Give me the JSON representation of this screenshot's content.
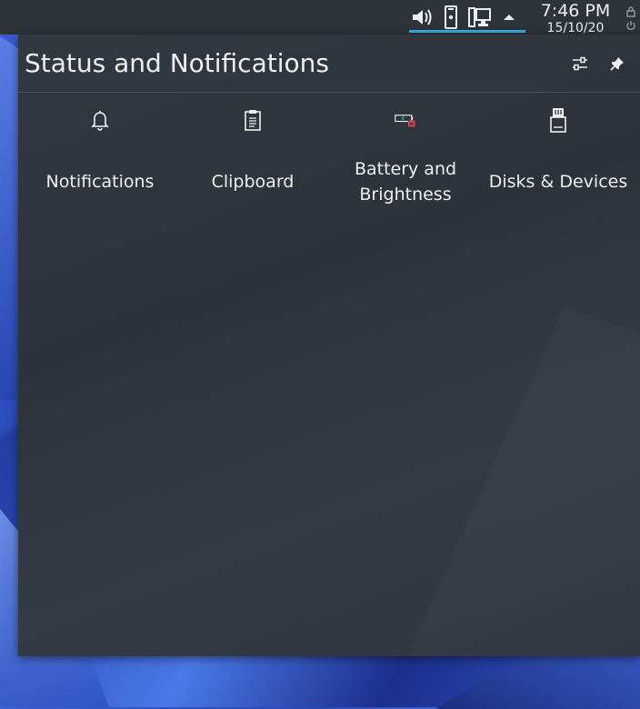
{
  "panel": {
    "clock": {
      "time": "7:46 PM",
      "date": "15/10/20"
    },
    "tray_icons": [
      "volume-icon",
      "kdeconnect-phone-icon",
      "network-wired-icon",
      "expand-arrow-icon"
    ],
    "side_icons": [
      "lock-icon",
      "power-icon"
    ]
  },
  "popup": {
    "title": "Status and Notifications",
    "header_buttons": [
      "configure-icon",
      "pin-icon"
    ],
    "applets": [
      {
        "label": "Notifications",
        "icon": "bell-icon"
      },
      {
        "label": "Clipboard",
        "icon": "clipboard-icon"
      },
      {
        "label_line1": "Battery and",
        "label_line2": "Brightness",
        "icon": "battery-missing-icon"
      },
      {
        "label": "Disks & Devices",
        "icon": "drive-removable-icon"
      }
    ]
  },
  "colors": {
    "panel_bg": "#2f343b",
    "popup_bg": "#31363e",
    "accent": "#3daee9",
    "text": "#eff0f1",
    "battery_error": "#da4453"
  }
}
